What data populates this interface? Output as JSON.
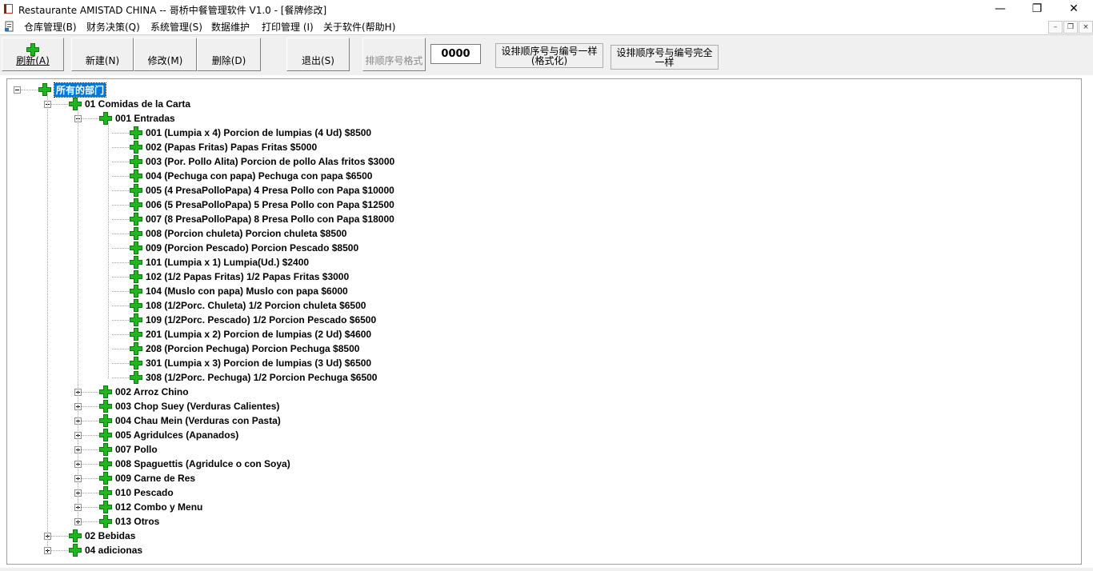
{
  "window": {
    "title": "Restaurante AMISTAD CHINA -- 哥桥中餐管理软件 V1.0 - [餐牌修改]",
    "controls": {
      "minimize": "—",
      "restore": "❐",
      "close": "✕"
    }
  },
  "menubar": {
    "items": [
      "仓库管理(B)",
      "财务决策(Q)",
      "系统管理(S)",
      "数据维护",
      "打印管理 (I)",
      "关于软件(帮助H)"
    ],
    "mdi_controls": [
      "–",
      "❐",
      "×"
    ]
  },
  "toolbar": {
    "refresh": "刷新(A)",
    "new": "新建(N)",
    "modify": "修改(M)",
    "delete": "删除(D)",
    "exit": "退出(S)",
    "format": "排顺序号格式",
    "number_value": "0000",
    "same_format": "设排顺序号与编号一样\n(格式化)",
    "same_exact": "设排顺序号与编号完全\n一样"
  },
  "tree": {
    "root": "所有的部门",
    "departments": [
      {
        "label": "01  Comidas de la Carta",
        "expanded": true,
        "categories": [
          {
            "label": "001  Entradas",
            "expanded": true,
            "items": [
              "001  (Lumpia x 4)  Porcion de lumpias (4 Ud)     $8500",
              "002  (Papas Fritas)  Papas Fritas     $5000",
              "003  (Por. Pollo Alita)  Porcion de pollo Alas fritos     $3000",
              "004  (Pechuga con papa)  Pechuga con papa     $6500",
              "005  (4 PresaPolloPapa)  4 Presa Pollo con Papa     $10000",
              "006  (5 PresaPolloPapa)  5 Presa Pollo con Papa     $12500",
              "007  (8 PresaPolloPapa)  8 Presa Pollo con Papa     $18000",
              "008  (Porcion chuleta)  Porcion chuleta     $8500",
              "009  (Porcion Pescado)  Porcion Pescado     $8500",
              "101  (Lumpia x 1)  Lumpia(Ud.)     $2400",
              "102  (1/2 Papas Fritas)  1/2 Papas Fritas     $3000",
              "104  (Muslo con papa)  Muslo con papa     $6000",
              "108  (1/2Porc. Chuleta)  1/2 Porcion chuleta     $6500",
              "109  (1/2Porc. Pescado)  1/2 Porcion Pescado     $6500",
              "201  (Lumpia x 2)  Porcion de lumpias (2 Ud)     $4600",
              "208  (Porcion Pechuga)  Porcion Pechuga     $8500",
              "301  (Lumpia x 3)  Porcion de lumpias (3 Ud)     $6500",
              "308  (1/2Porc. Pechuga)  1/2 Porcion Pechuga     $6500"
            ]
          },
          {
            "label": "002  Arroz Chino",
            "expanded": false
          },
          {
            "label": "003  Chop Suey (Verduras Calientes)",
            "expanded": false
          },
          {
            "label": "004  Chau Mein (Verduras con Pasta)",
            "expanded": false
          },
          {
            "label": "005  Agridulces (Apanados)",
            "expanded": false
          },
          {
            "label": "007  Pollo",
            "expanded": false
          },
          {
            "label": "008  Spaguettis (Agridulce o con Soya)",
            "expanded": false
          },
          {
            "label": "009  Carne de Res",
            "expanded": false
          },
          {
            "label": "010  Pescado",
            "expanded": false
          },
          {
            "label": "012  Combo y Menu",
            "expanded": false
          },
          {
            "label": "013  Otros",
            "expanded": false
          }
        ]
      },
      {
        "label": "02  Bebidas",
        "expanded": false
      },
      {
        "label": "04  adicionas",
        "expanded": false
      }
    ]
  },
  "colors": {
    "plus_green": "#22b522",
    "plus_dark": "#0a7a0a",
    "selection": "#0078d7"
  }
}
